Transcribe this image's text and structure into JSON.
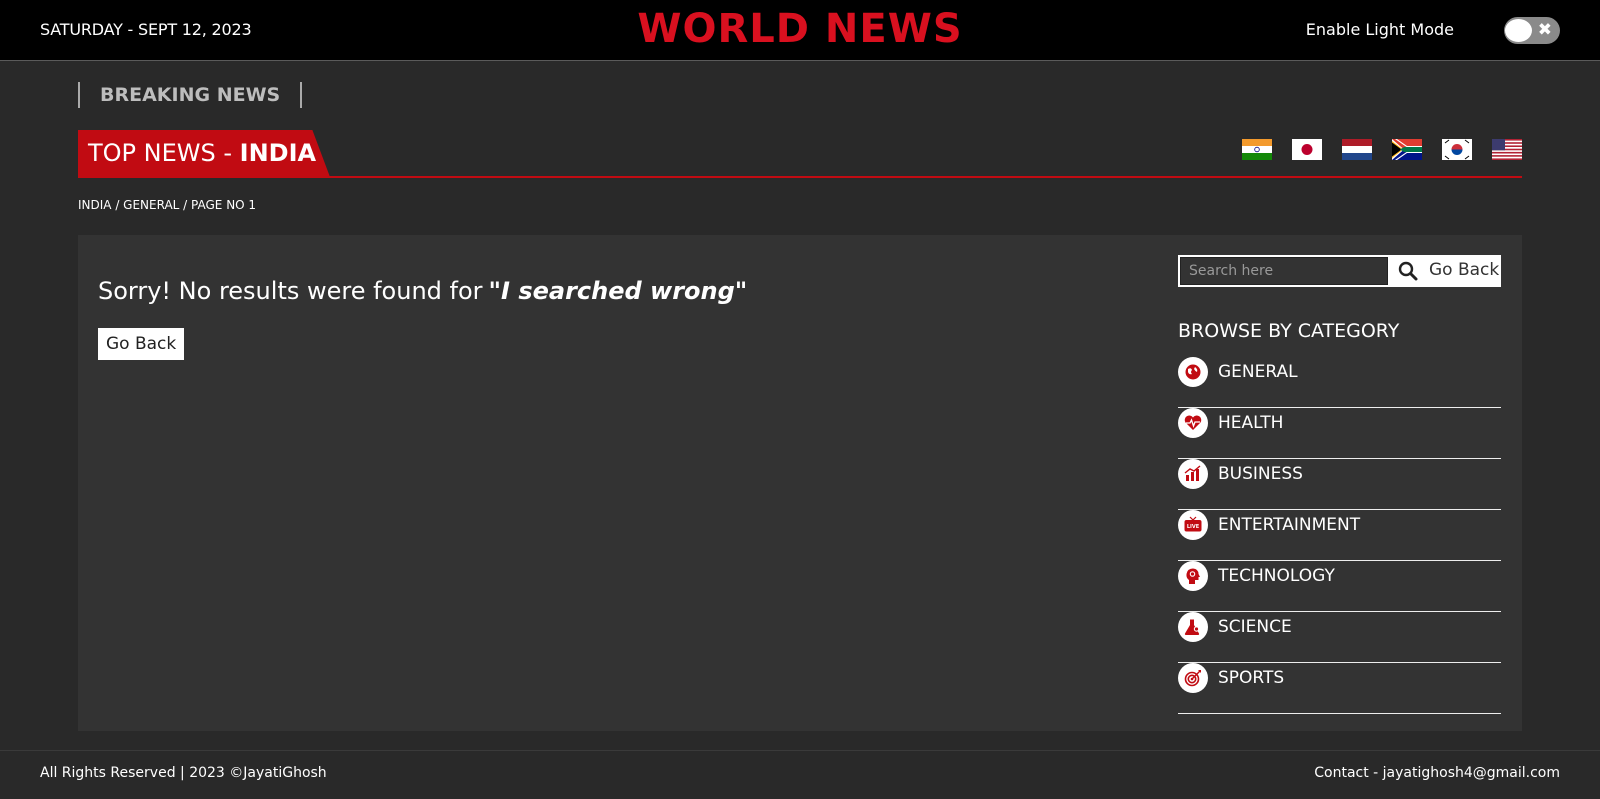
{
  "header": {
    "date": "SATURDAY - SEPT 12, 2023",
    "logo": "WORLD NEWS",
    "mode_label": "Enable Light Mode"
  },
  "breaking": {
    "label": "BREAKING NEWS"
  },
  "top_news": {
    "prefix": "TOP NEWS - ",
    "country": "INDIA",
    "flags": [
      "india-flag",
      "japan-flag",
      "netherlands-flag",
      "south-africa-flag",
      "south-korea-flag",
      "usa-flag"
    ]
  },
  "breadcrumb": "INDIA / GENERAL / PAGE NO 1",
  "main": {
    "message": "Sorry! No results were found for",
    "query": "\"I searched wrong\"",
    "go_back": "Go Back"
  },
  "sidebar": {
    "search_placeholder": "Search here",
    "search_go_back": "Go Back",
    "browse_title": "BROWSE BY CATEGORY",
    "categories": [
      {
        "label": "GENERAL",
        "icon": "globe-icon"
      },
      {
        "label": "HEALTH",
        "icon": "heartbeat-icon"
      },
      {
        "label": "BUSINESS",
        "icon": "chart-icon"
      },
      {
        "label": "ENTERTAINMENT",
        "icon": "live-tv-icon"
      },
      {
        "label": "TECHNOLOGY",
        "icon": "tech-head-icon"
      },
      {
        "label": "SCIENCE",
        "icon": "flask-icon"
      },
      {
        "label": "SPORTS",
        "icon": "target-icon"
      }
    ]
  },
  "footer": {
    "left": "All Rights Reserved | 2023 ©JayatiGhosh",
    "right": "Contact - jayatighosh4@gmail.com"
  },
  "colors": {
    "accent": "#d9101f",
    "header_bg": "#000000",
    "page_bg": "#292929",
    "panel_bg": "#333333"
  }
}
